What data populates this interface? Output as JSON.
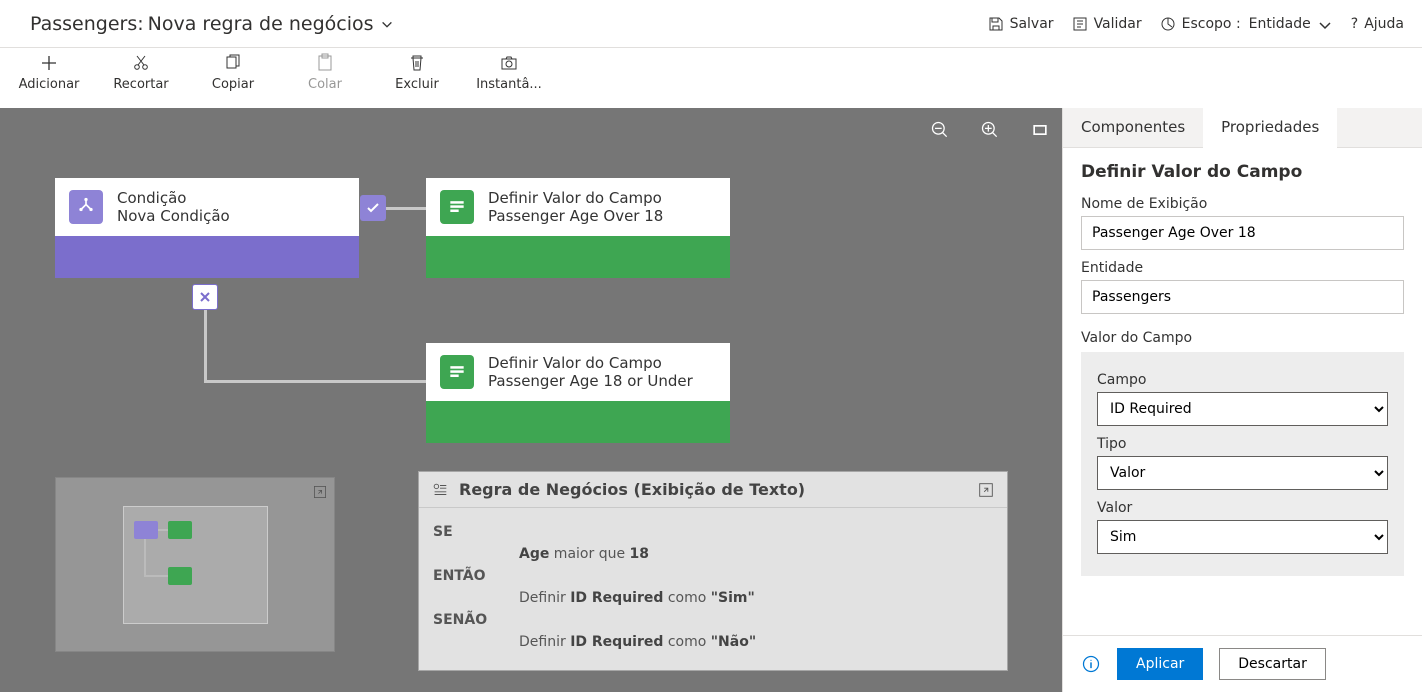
{
  "header": {
    "entity": "Passengers",
    "rule_name": "Nova regra de negócios",
    "save": "Salvar",
    "validate": "Validar",
    "scope_label": "Escopo :",
    "scope_value": "Entidade",
    "help": "Ajuda"
  },
  "toolbar": {
    "add": "Adicionar",
    "cut": "Recortar",
    "copy": "Copiar",
    "paste": "Colar",
    "delete": "Excluir",
    "snapshot": "Instantâ..."
  },
  "canvas": {
    "condition_node": {
      "title": "Condição",
      "subtitle": "Nova Condição"
    },
    "action_then": {
      "title": "Definir Valor do Campo",
      "subtitle": "Passenger Age Over 18"
    },
    "action_else": {
      "title": "Definir Valor do Campo",
      "subtitle": "Passenger Age 18 or Under"
    }
  },
  "textview": {
    "header": "Regra de Negócios (Exibição de Texto)",
    "if_label": "SE",
    "if_text_pre": "Age",
    "if_text_mid": " maior que ",
    "if_text_val": "18",
    "then_label": "ENTÃO",
    "then_text_pre": "Definir ",
    "then_field": "ID Required",
    "then_text_mid": " como ",
    "then_val": "\"Sim\"",
    "else_label": "SENÃO",
    "else_text_pre": "Definir ",
    "else_field": "ID Required",
    "else_text_mid": " como ",
    "else_val": "\"Não\""
  },
  "panel": {
    "tab_components": "Componentes",
    "tab_properties": "Propriedades",
    "title": "Definir Valor do Campo",
    "display_name_label": "Nome de Exibição",
    "display_name_value": "Passenger Age Over 18",
    "entity_label": "Entidade",
    "entity_value": "Passengers",
    "field_value_label": "Valor do Campo",
    "field_label": "Campo",
    "field_value": "ID Required",
    "type_label": "Tipo",
    "type_value": "Valor",
    "value_label": "Valor",
    "value_value": "Sim",
    "apply": "Aplicar",
    "discard": "Descartar"
  }
}
